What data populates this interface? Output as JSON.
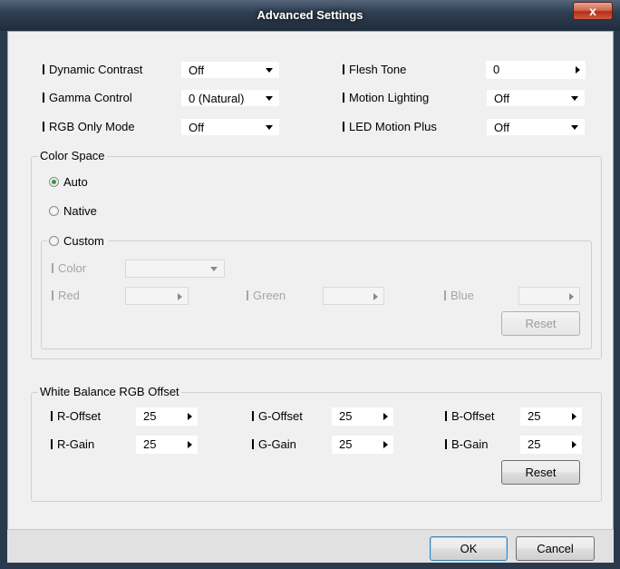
{
  "window": {
    "title": "Advanced Settings",
    "close_label": "x"
  },
  "settings": {
    "dynamic_contrast": {
      "label": "Dynamic Contrast",
      "value": "Off"
    },
    "gamma_control": {
      "label": "Gamma Control",
      "value": "0 (Natural)"
    },
    "rgb_only_mode": {
      "label": "RGB Only Mode",
      "value": "Off"
    },
    "flesh_tone": {
      "label": "Flesh Tone",
      "value": "0"
    },
    "motion_lighting": {
      "label": "Motion Lighting",
      "value": "Off"
    },
    "led_motion_plus": {
      "label": "LED Motion Plus",
      "value": "Off"
    }
  },
  "color_space": {
    "legend": "Color Space",
    "auto": "Auto",
    "native": "Native",
    "custom": "Custom",
    "selected": "Auto",
    "color_label": "Color",
    "color_value": "",
    "red_label": "Red",
    "red_value": "",
    "green_label": "Green",
    "green_value": "",
    "blue_label": "Blue",
    "blue_value": "",
    "reset_label": "Reset"
  },
  "white_balance": {
    "legend": "White Balance RGB Offset",
    "r_offset": {
      "label": "R-Offset",
      "value": "25"
    },
    "g_offset": {
      "label": "G-Offset",
      "value": "25"
    },
    "b_offset": {
      "label": "B-Offset",
      "value": "25"
    },
    "r_gain": {
      "label": "R-Gain",
      "value": "25"
    },
    "g_gain": {
      "label": "G-Gain",
      "value": "25"
    },
    "b_gain": {
      "label": "B-Gain",
      "value": "25"
    },
    "reset_label": "Reset"
  },
  "footer": {
    "ok_label": "OK",
    "cancel_label": "Cancel"
  },
  "colors": {
    "title_bar": "#2f3f52",
    "client_bg": "#f0f0f0",
    "close_red": "#c64b33",
    "radio_selected": "#3a9a3a",
    "disabled_text": "#a5a5a5"
  }
}
